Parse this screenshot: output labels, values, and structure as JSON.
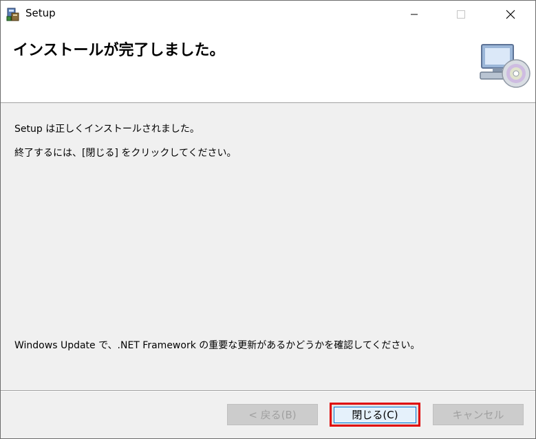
{
  "window": {
    "title": "Setup"
  },
  "header": {
    "title": "インストールが完了しました。"
  },
  "body": {
    "line1": "Setup は正しくインストールされました。",
    "line2": "終了するには、[閉じる] をクリックしてください。",
    "footer_note": "Windows Update で、.NET Framework の重要な更新があるかどうかを確認してください。"
  },
  "buttons": {
    "back": "< 戻る(B)",
    "close": "閉じる(C)",
    "cancel": "キャンセル"
  },
  "colors": {
    "highlight": "#e00000",
    "focus": "#0078d7"
  }
}
